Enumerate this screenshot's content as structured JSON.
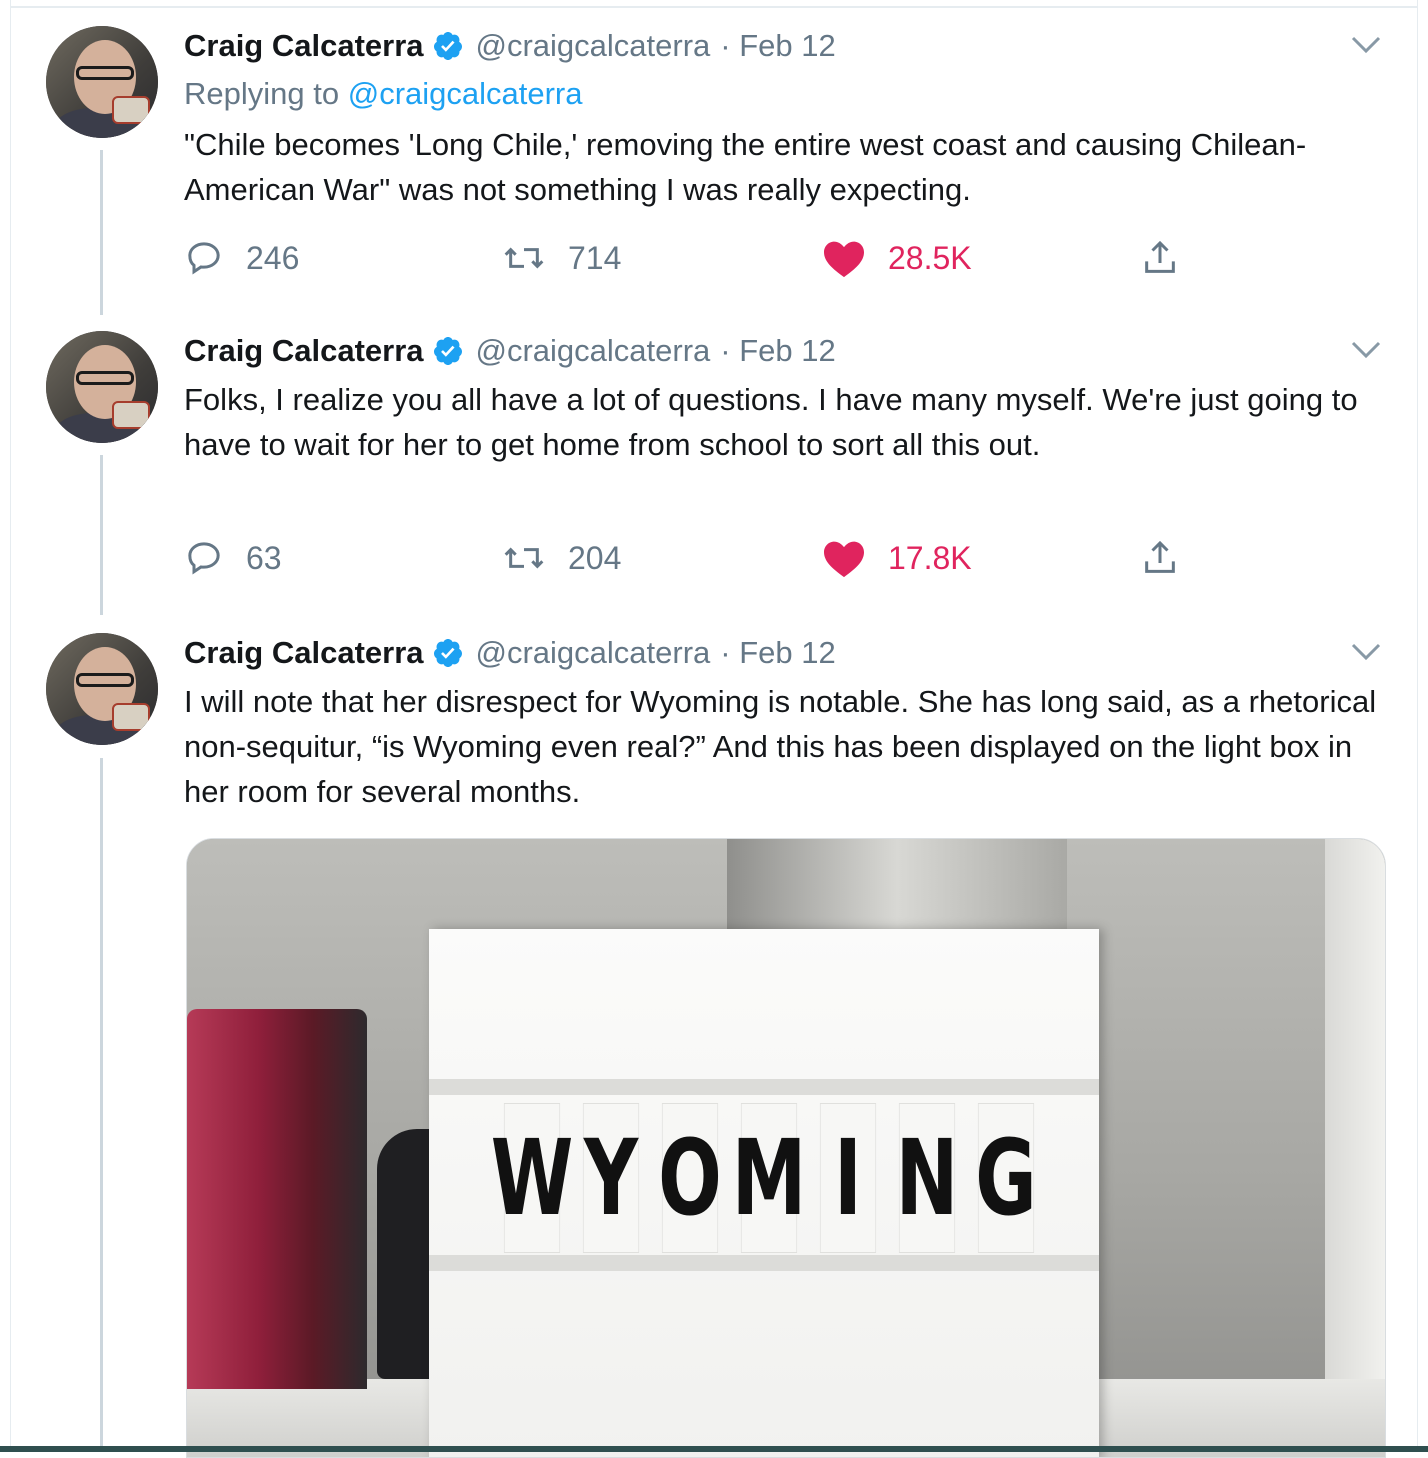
{
  "colors": {
    "name": "#14171a",
    "muted": "#657786",
    "link": "#1da1f2",
    "like": "#e0245e",
    "verified": "#1da1f2"
  },
  "tweets": [
    {
      "author_name": "Craig Calcaterra",
      "handle": "@craigcalcaterra",
      "date": "· Feb 12",
      "reply_prefix": "Replying to",
      "reply_handle": "@craigcalcaterra",
      "text": "\"Chile becomes 'Long Chile,' removing the entire west coast and causing Chilean-American War\" was not something I was really expecting.",
      "replies": "246",
      "retweets": "714",
      "likes": "28.5K"
    },
    {
      "author_name": "Craig Calcaterra",
      "handle": "@craigcalcaterra",
      "date": "· Feb 12",
      "text": "Folks, I realize you all have a lot of questions. I have many myself. We're just going to have to wait for her to get home from school to sort all this out.",
      "replies": "63",
      "retweets": "204",
      "likes": "17.8K"
    },
    {
      "author_name": "Craig Calcaterra",
      "handle": "@craigcalcaterra",
      "date": "· Feb 12",
      "text": "I will note that her disrespect for Wyoming is notable. She has long said, as a rhetorical non-sequitur, “is Wyoming even real?” And this has been displayed on the light box in her room for several months.",
      "media": {
        "lightbox_letters": [
          "W",
          "Y",
          "O",
          "M",
          "I",
          "N",
          "G"
        ]
      }
    }
  ],
  "icons": [
    "verified-badge-icon",
    "chevron-down-icon",
    "reply-icon",
    "retweet-icon",
    "like-heart-icon",
    "share-icon"
  ]
}
